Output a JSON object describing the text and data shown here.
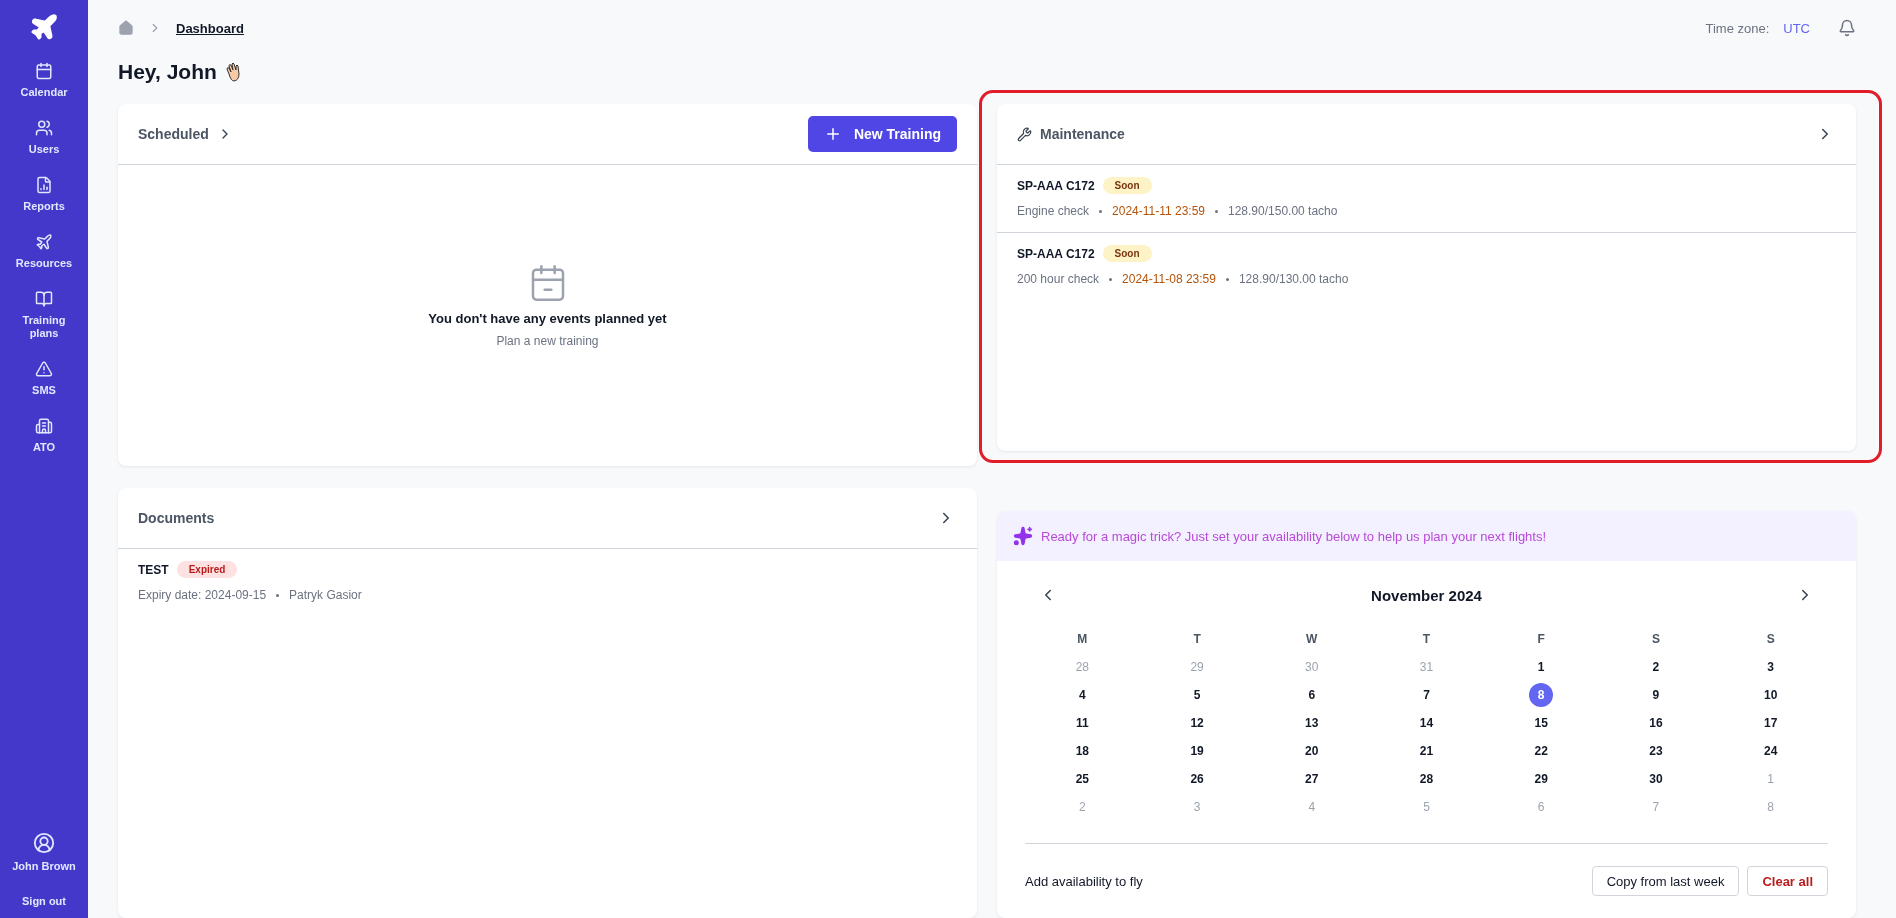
{
  "sidebar": {
    "items": [
      {
        "label": "Calendar"
      },
      {
        "label": "Users"
      },
      {
        "label": "Reports"
      },
      {
        "label": "Resources"
      },
      {
        "label": "Training plans"
      },
      {
        "label": "SMS"
      },
      {
        "label": "ATO"
      }
    ],
    "user": {
      "name": "John Brown"
    },
    "sign_out": "Sign out"
  },
  "breadcrumb": {
    "current": "Dashboard"
  },
  "timezone": {
    "label": "Time zone:",
    "value": "UTC"
  },
  "greeting": "Hey, John",
  "scheduled": {
    "title": "Scheduled",
    "button": "New Training",
    "empty_title": "You don't have any events planned yet",
    "empty_hint": "Plan a new training"
  },
  "maintenance": {
    "title": "Maintenance",
    "highlighted": true,
    "items": [
      {
        "aircraft": "SP-AAA C172",
        "badge": "Soon",
        "kind": "warning",
        "task": "Engine check",
        "due": "2024-11-11 23:59",
        "usage": "128.90/150.00 tacho"
      },
      {
        "aircraft": "SP-AAA C172",
        "badge": "Soon",
        "kind": "warning",
        "task": "200 hour check",
        "due": "2024-11-08 23:59",
        "usage": "128.90/130.00 tacho"
      }
    ]
  },
  "documents": {
    "title": "Documents",
    "items": [
      {
        "name": "TEST",
        "badge": "Expired",
        "kind": "danger",
        "expiry": "Expiry date: 2024-09-15",
        "owner": "Patryk Gasior"
      }
    ]
  },
  "availability": {
    "banner": "Ready for a magic trick? Just set your availability below to help us plan your next flights!",
    "month": "November 2024",
    "weekdays": [
      "M",
      "T",
      "W",
      "T",
      "F",
      "S",
      "S"
    ],
    "weeks": [
      [
        {
          "day": "28",
          "muted": true,
          "selected": false
        },
        {
          "day": "29",
          "muted": true,
          "selected": false
        },
        {
          "day": "30",
          "muted": true,
          "selected": false
        },
        {
          "day": "31",
          "muted": true,
          "selected": false
        },
        {
          "day": "1",
          "muted": false,
          "selected": false
        },
        {
          "day": "2",
          "muted": false,
          "selected": false
        },
        {
          "day": "3",
          "muted": false,
          "selected": false
        }
      ],
      [
        {
          "day": "4",
          "muted": false,
          "selected": false
        },
        {
          "day": "5",
          "muted": false,
          "selected": false
        },
        {
          "day": "6",
          "muted": false,
          "selected": false
        },
        {
          "day": "7",
          "muted": false,
          "selected": false
        },
        {
          "day": "8",
          "muted": false,
          "selected": true
        },
        {
          "day": "9",
          "muted": false,
          "selected": false
        },
        {
          "day": "10",
          "muted": false,
          "selected": false
        }
      ],
      [
        {
          "day": "11",
          "muted": false,
          "selected": false
        },
        {
          "day": "12",
          "muted": false,
          "selected": false
        },
        {
          "day": "13",
          "muted": false,
          "selected": false
        },
        {
          "day": "14",
          "muted": false,
          "selected": false
        },
        {
          "day": "15",
          "muted": false,
          "selected": false
        },
        {
          "day": "16",
          "muted": false,
          "selected": false
        },
        {
          "day": "17",
          "muted": false,
          "selected": false
        }
      ],
      [
        {
          "day": "18",
          "muted": false,
          "selected": false
        },
        {
          "day": "19",
          "muted": false,
          "selected": false
        },
        {
          "day": "20",
          "muted": false,
          "selected": false
        },
        {
          "day": "21",
          "muted": false,
          "selected": false
        },
        {
          "day": "22",
          "muted": false,
          "selected": false
        },
        {
          "day": "23",
          "muted": false,
          "selected": false
        },
        {
          "day": "24",
          "muted": false,
          "selected": false
        }
      ],
      [
        {
          "day": "25",
          "muted": false,
          "selected": false
        },
        {
          "day": "26",
          "muted": false,
          "selected": false
        },
        {
          "day": "27",
          "muted": false,
          "selected": false
        },
        {
          "day": "28",
          "muted": false,
          "selected": false
        },
        {
          "day": "29",
          "muted": false,
          "selected": false
        },
        {
          "day": "30",
          "muted": false,
          "selected": false
        },
        {
          "day": "1",
          "muted": true,
          "selected": false
        }
      ],
      [
        {
          "day": "2",
          "muted": true,
          "selected": false
        },
        {
          "day": "3",
          "muted": true,
          "selected": false
        },
        {
          "day": "4",
          "muted": true,
          "selected": false
        },
        {
          "day": "5",
          "muted": true,
          "selected": false
        },
        {
          "day": "6",
          "muted": true,
          "selected": false
        },
        {
          "day": "7",
          "muted": true,
          "selected": false
        },
        {
          "day": "8",
          "muted": true,
          "selected": false
        }
      ]
    ],
    "footer_label": "Add availability to fly",
    "copy_button": "Copy from last week",
    "clear_button": "Clear all"
  }
}
